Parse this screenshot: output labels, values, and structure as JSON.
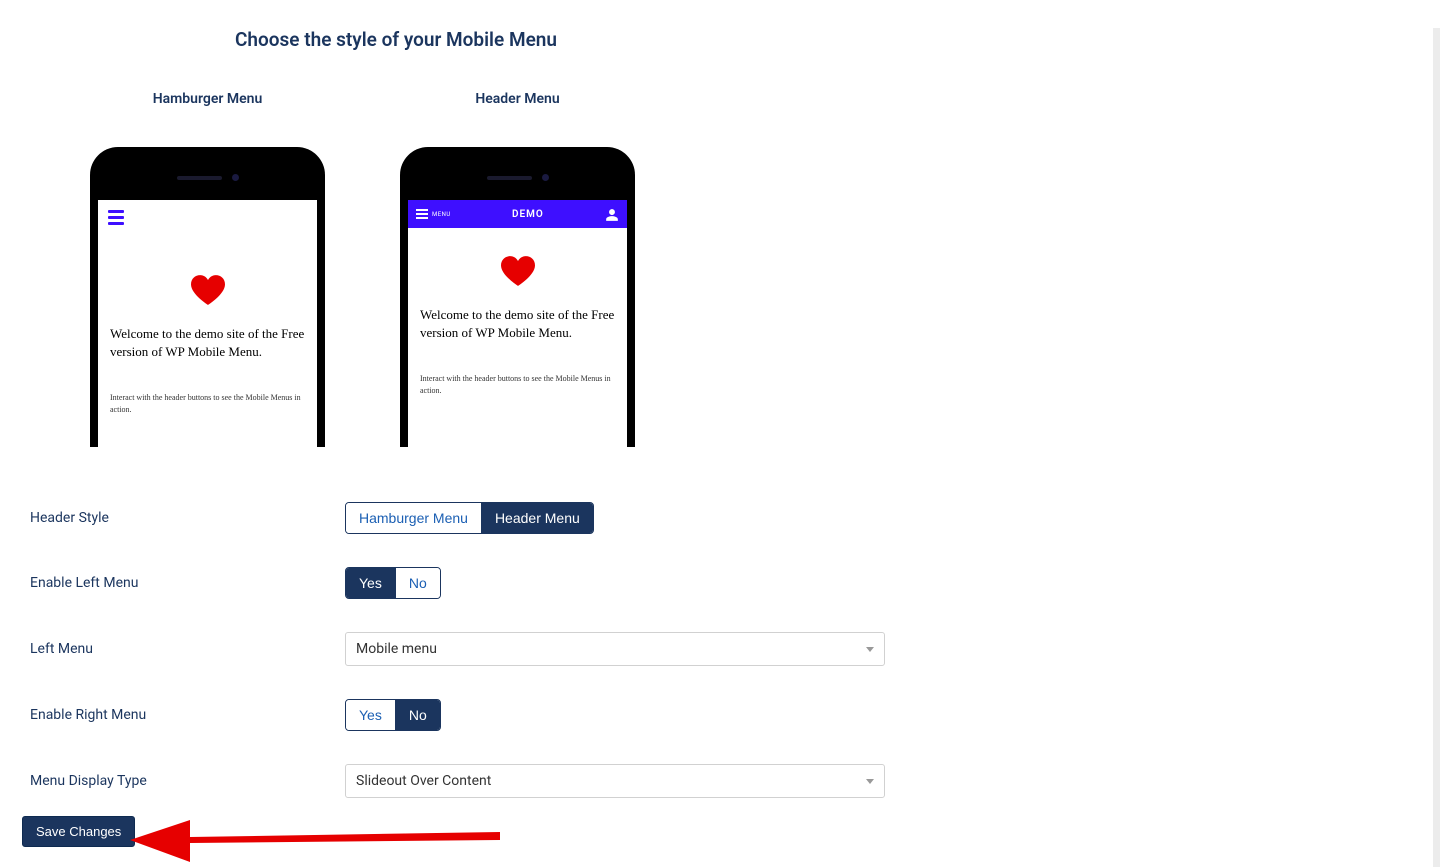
{
  "page_title": "Choose the style of your Mobile Menu",
  "previews": {
    "hamburger_label": "Hamburger Menu",
    "header_label": "Header Menu",
    "header_demo_title": "DEMO",
    "header_menu_word": "MENU",
    "body_text": "Welcome to the demo site of the Free version of WP Mobile Menu.",
    "sub_text": "Interact with the header buttons to see the Mobile Menus in action."
  },
  "form": {
    "header_style": {
      "label": "Header Style",
      "options": {
        "hamburger": "Hamburger Menu",
        "header": "Header Menu"
      },
      "selected": "header"
    },
    "enable_left": {
      "label": "Enable Left Menu",
      "options": {
        "yes": "Yes",
        "no": "No"
      },
      "selected": "yes"
    },
    "left_menu": {
      "label": "Left Menu",
      "value": "Mobile menu"
    },
    "enable_right": {
      "label": "Enable Right Menu",
      "options": {
        "yes": "Yes",
        "no": "No"
      },
      "selected": "no"
    },
    "display_type": {
      "label": "Menu Display Type",
      "value": "Slideout Over Content"
    }
  },
  "save_button": "Save Changes"
}
